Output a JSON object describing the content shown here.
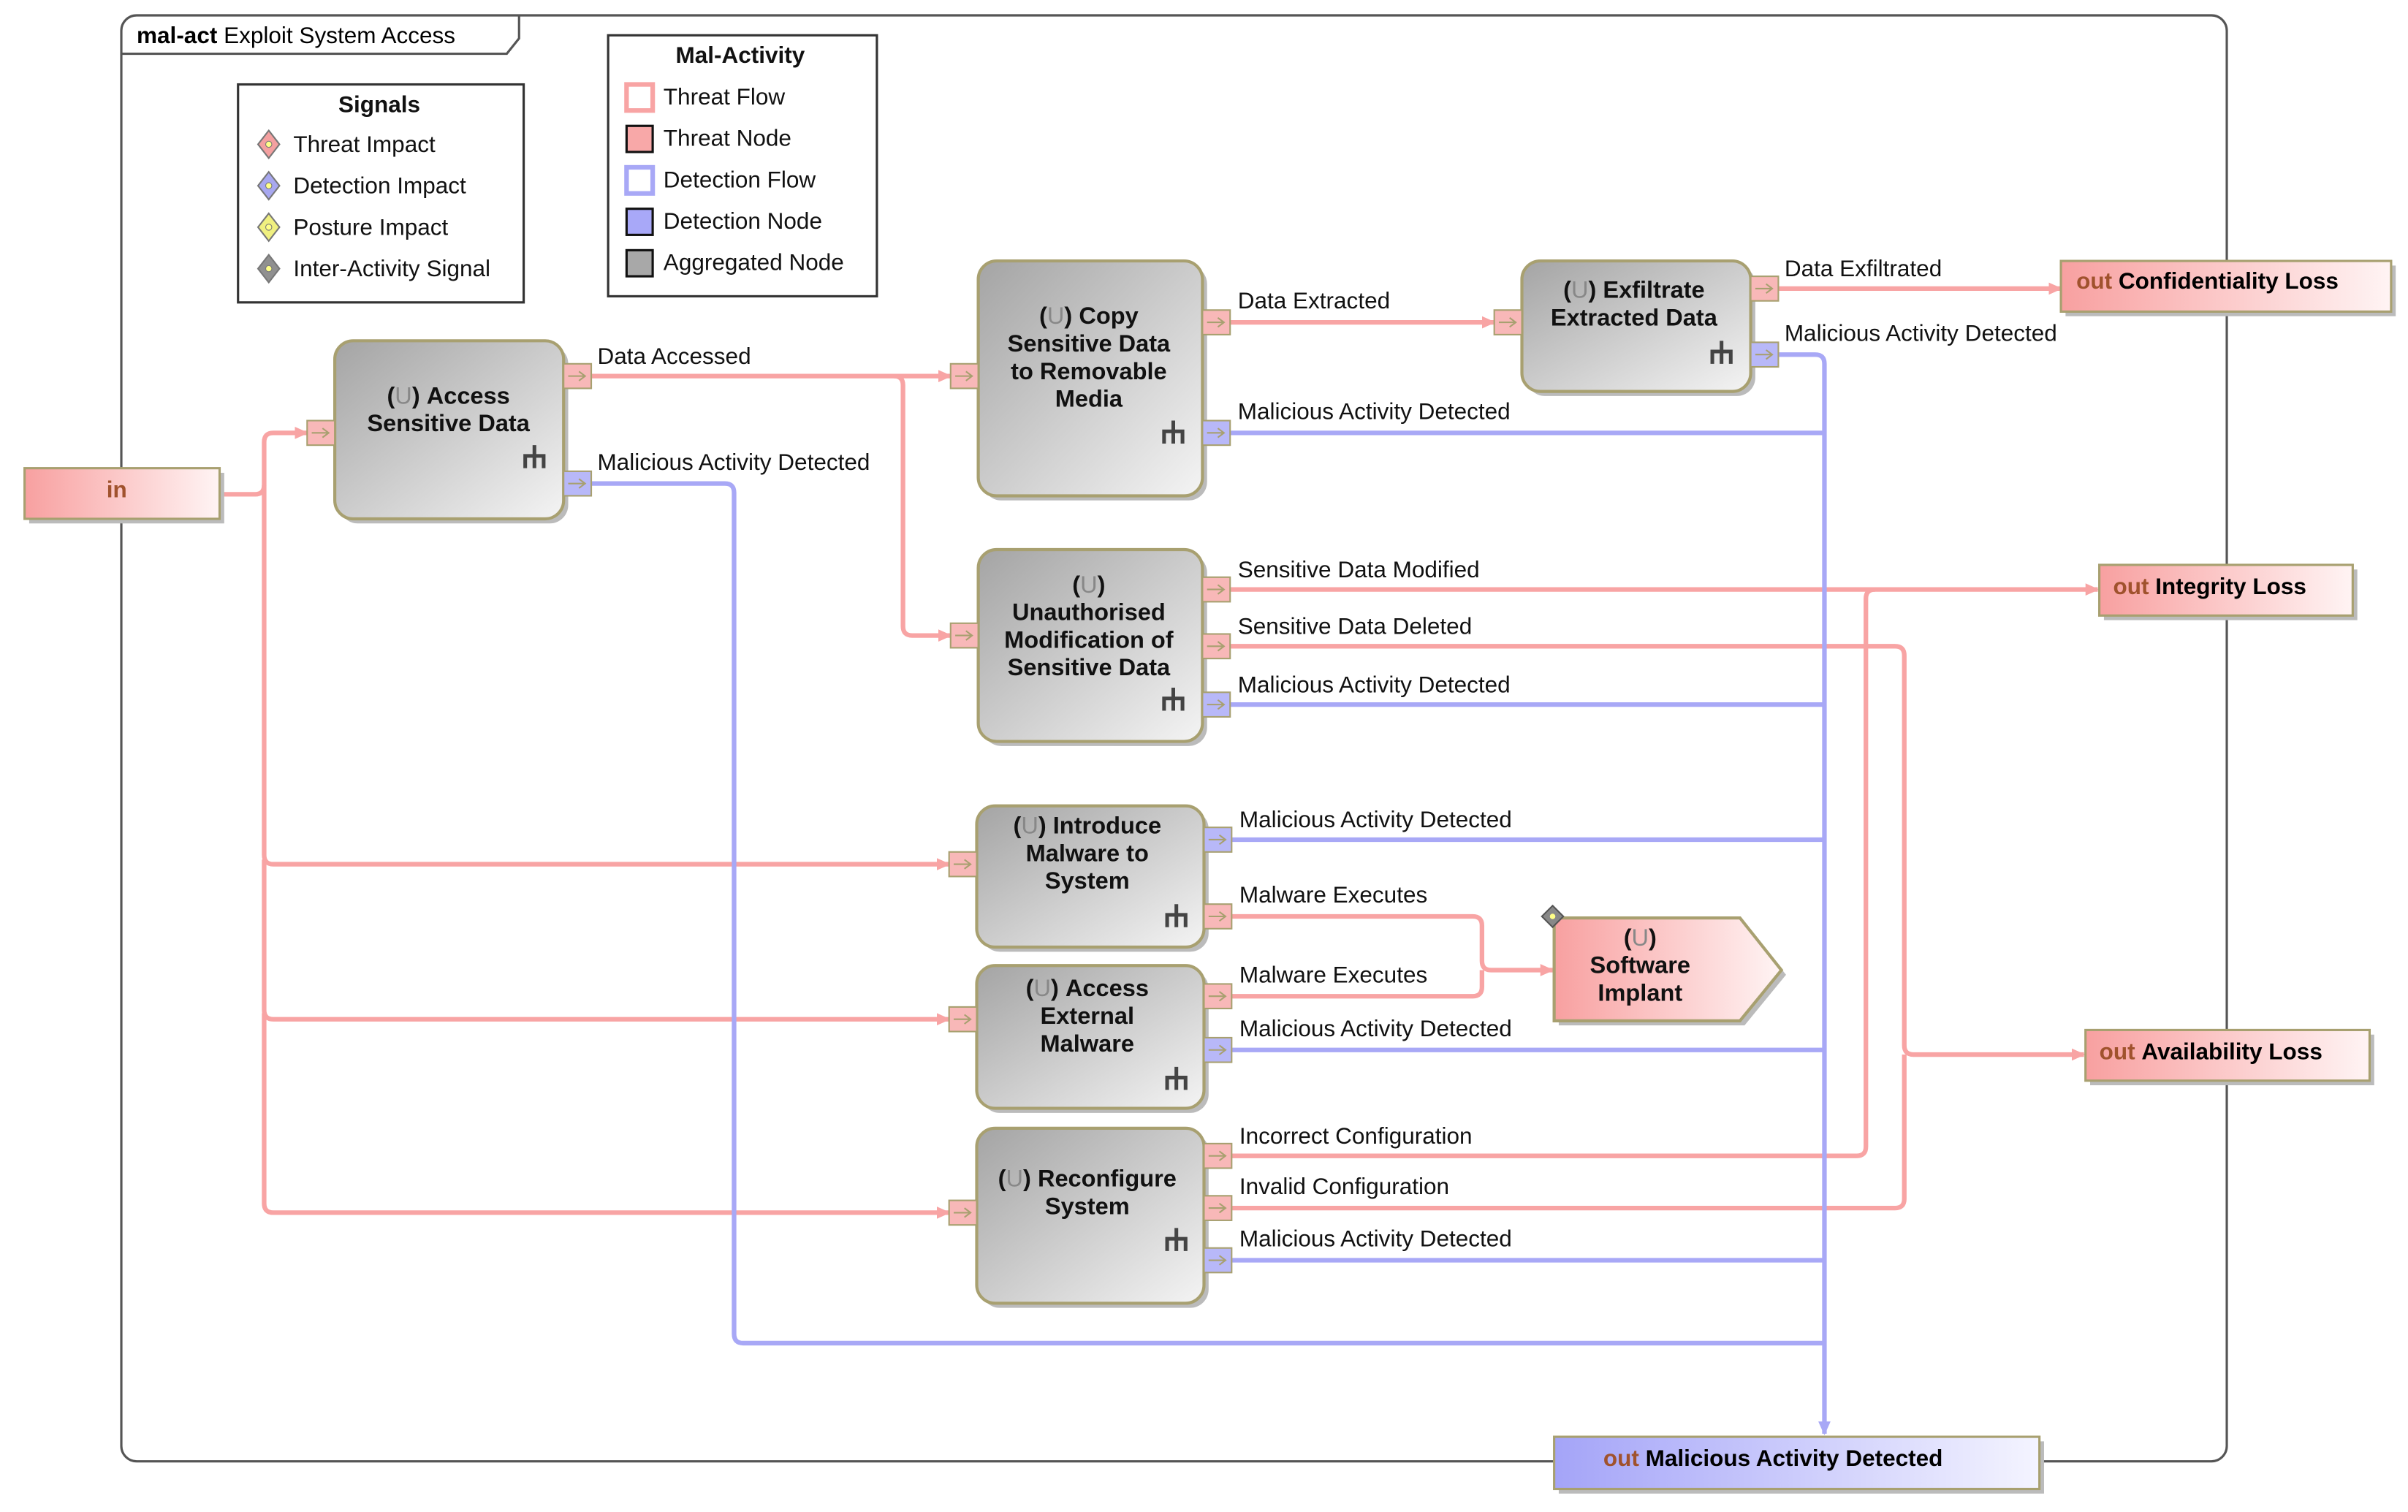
{
  "frame": {
    "kind": "mal-act",
    "title": "Exploit System Access"
  },
  "legend_signals": {
    "title": "Signals",
    "items": [
      {
        "label": "Threat Impact",
        "color": "#f4a0a0"
      },
      {
        "label": "Detection Impact",
        "color": "#a8a8f0"
      },
      {
        "label": "Posture Impact",
        "color": "#f0f080"
      },
      {
        "label": "Inter-Activity Signal",
        "color": "#909090"
      }
    ]
  },
  "legend_mal_activity": {
    "title": "Mal-Activity",
    "items": [
      {
        "label": "Threat Flow",
        "color": "#f8a4a4"
      },
      {
        "label": "Threat Node",
        "color": "#f8a8a8"
      },
      {
        "label": "Detection Flow",
        "color": "#a8a8f6"
      },
      {
        "label": "Detection Node",
        "color": "#a8a8f8"
      },
      {
        "label": "Aggregated Node",
        "color": "#a8a8a8"
      }
    ]
  },
  "input": {
    "label": "in"
  },
  "nodes": {
    "access": {
      "marking": "U",
      "l1": "Access",
      "l2": "Sensitive Data"
    },
    "copy": {
      "marking": "U",
      "l1": "Copy",
      "l2": "Sensitive Data",
      "l3": "to Removable",
      "l4": "Media"
    },
    "unauth": {
      "marking": "U",
      "l2": "Unauthorised",
      "l3": "Modification of",
      "l4": "Sensitive Data"
    },
    "exfil": {
      "marking": "U",
      "l1": "Exfiltrate",
      "l2": "Extracted Data"
    },
    "introduce": {
      "marking": "U",
      "l1": "Introduce",
      "l2": "Malware to",
      "l3": "System"
    },
    "external": {
      "marking": "U",
      "l1": "Access",
      "l2": "External",
      "l3": "Malware"
    },
    "reconfigure": {
      "marking": "U",
      "l1": "Reconfigure",
      "l2": "System"
    },
    "implant": {
      "marking": "U",
      "l2": "Software",
      "l3": "Implant"
    }
  },
  "outputs": {
    "confidentiality": {
      "prefix": "out",
      "label": "Confidentiality Loss"
    },
    "integrity": {
      "prefix": "out",
      "label": "Integrity Loss"
    },
    "availability": {
      "prefix": "out",
      "label": "Availability Loss"
    },
    "malicious": {
      "prefix": "out",
      "label": "Malicious Activity Detected"
    }
  },
  "flow_labels": [
    "Data Accessed",
    "Malicious Activity Detected",
    "Data Extracted",
    "Malicious Activity Detected",
    "Data Exfiltrated",
    "Malicious Activity Detected",
    "Sensitive Data Modified",
    "Sensitive Data Deleted",
    "Malicious Activity Detected",
    "Malicious Activity Detected",
    "Malware Executes",
    "Malware Executes",
    "Malicious Activity Detected",
    "Incorrect Configuration",
    "Invalid Configuration",
    "Malicious Activity Detected"
  ]
}
